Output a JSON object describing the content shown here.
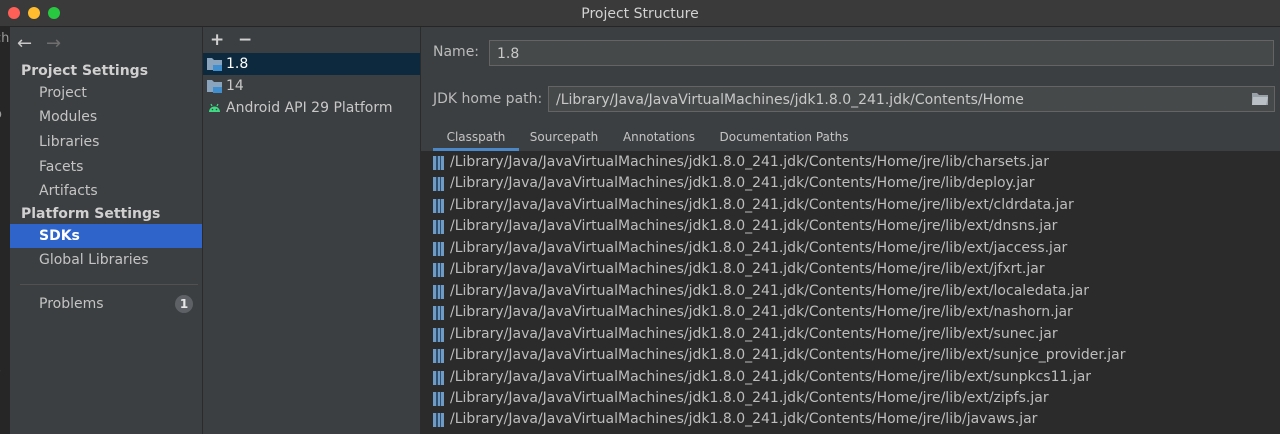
{
  "window": {
    "title": "Project Structure"
  },
  "left_edge": {
    "top_text": "ch",
    "mid_text": "o",
    "bottom_text": "s"
  },
  "nav": {
    "back_icon": "arrow-left-icon",
    "forward_icon": "arrow-right-icon"
  },
  "sidebar": {
    "project_settings_header": "Project Settings",
    "project_items": [
      "Project",
      "Modules",
      "Libraries",
      "Facets",
      "Artifacts"
    ],
    "platform_settings_header": "Platform Settings",
    "platform_items": [
      "SDKs",
      "Global Libraries"
    ],
    "selected": "SDKs",
    "problems_label": "Problems",
    "problems_count": "1"
  },
  "sdk_list": {
    "add_label": "+",
    "remove_label": "−",
    "items": [
      "1.8",
      "14",
      "Android API 29 Platform"
    ],
    "selected": "1.8"
  },
  "details": {
    "name_label": "Name:",
    "name_value": "1.8",
    "jdk_home_label": "JDK home path:",
    "jdk_home_value": "/Library/Java/JavaVirtualMachines/jdk1.8.0_241.jdk/Contents/Home",
    "tabs": [
      "Classpath",
      "Sourcepath",
      "Annotations",
      "Documentation Paths"
    ],
    "active_tab": "Classpath",
    "classpath": [
      "/Library/Java/JavaVirtualMachines/jdk1.8.0_241.jdk/Contents/Home/jre/lib/charsets.jar",
      "/Library/Java/JavaVirtualMachines/jdk1.8.0_241.jdk/Contents/Home/jre/lib/deploy.jar",
      "/Library/Java/JavaVirtualMachines/jdk1.8.0_241.jdk/Contents/Home/jre/lib/ext/cldrdata.jar",
      "/Library/Java/JavaVirtualMachines/jdk1.8.0_241.jdk/Contents/Home/jre/lib/ext/dnsns.jar",
      "/Library/Java/JavaVirtualMachines/jdk1.8.0_241.jdk/Contents/Home/jre/lib/ext/jaccess.jar",
      "/Library/Java/JavaVirtualMachines/jdk1.8.0_241.jdk/Contents/Home/jre/lib/ext/jfxrt.jar",
      "/Library/Java/JavaVirtualMachines/jdk1.8.0_241.jdk/Contents/Home/jre/lib/ext/localedata.jar",
      "/Library/Java/JavaVirtualMachines/jdk1.8.0_241.jdk/Contents/Home/jre/lib/ext/nashorn.jar",
      "/Library/Java/JavaVirtualMachines/jdk1.8.0_241.jdk/Contents/Home/jre/lib/ext/sunec.jar",
      "/Library/Java/JavaVirtualMachines/jdk1.8.0_241.jdk/Contents/Home/jre/lib/ext/sunjce_provider.jar",
      "/Library/Java/JavaVirtualMachines/jdk1.8.0_241.jdk/Contents/Home/jre/lib/ext/sunpkcs11.jar",
      "/Library/Java/JavaVirtualMachines/jdk1.8.0_241.jdk/Contents/Home/jre/lib/ext/zipfs.jar",
      "/Library/Java/JavaVirtualMachines/jdk1.8.0_241.jdk/Contents/Home/jre/lib/javaws.jar"
    ]
  },
  "colors": {
    "selection": "#2f65ca",
    "sdk_selection": "#0d293e",
    "tab_underline": "#4a88c7",
    "panel": "#3c3f41",
    "list_bg": "#2b2b2b"
  }
}
